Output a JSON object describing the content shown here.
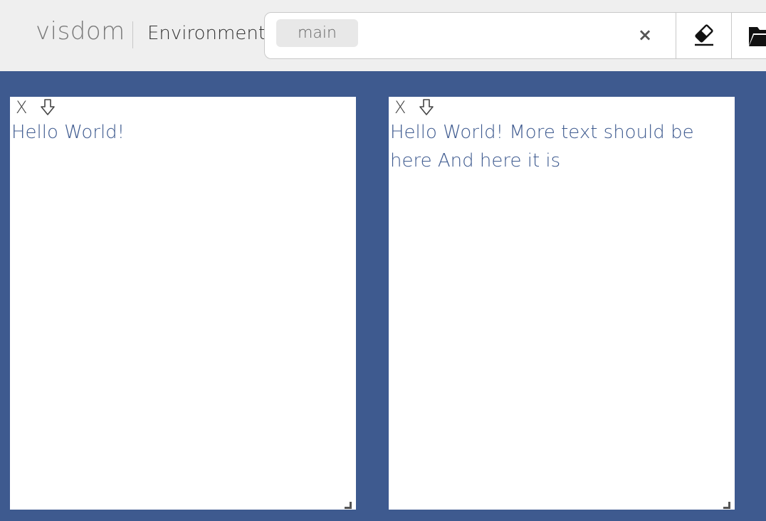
{
  "navbar": {
    "brand": "visdom",
    "env_label": "Environment",
    "env_selected": "main",
    "clear_symbol": "×",
    "eraser_icon": "eraser-icon",
    "folder_icon": "folder-open-icon"
  },
  "panes": [
    {
      "close_label": "X",
      "download_icon": "download-arrow-icon",
      "text": "Hello World!"
    },
    {
      "close_label": "X",
      "download_icon": "download-arrow-icon",
      "text": "Hello World! More text should be here And here it is"
    }
  ],
  "colors": {
    "background": "#3e5a8f",
    "navbar": "#efefef",
    "pane_text": "#3e5a8f"
  }
}
